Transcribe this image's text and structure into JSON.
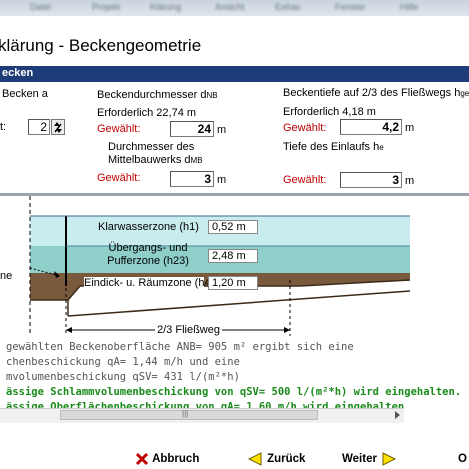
{
  "window": {
    "title": "klärung - Beckengeometrie",
    "section_title": "ecken",
    "blurred_tabs": [
      "Datei",
      "Projekt",
      "Klärung",
      "Ansicht",
      "Extras",
      "Fenster",
      "Hilfe"
    ]
  },
  "form": {
    "becken_label": "Becken a",
    "count_label": "t:",
    "count_value": "2",
    "durchmesser_label": "Beckendurchmesser d",
    "durchmesser_sub": "NB",
    "durchmesser_required": "Erforderlich 22,74 m",
    "gewaehlt_label": "Gewählt:",
    "durchmesser_value": "24",
    "unit_m": "m",
    "mittel_label_1": "Durchmesser des",
    "mittel_label_2": "Mittelbauwerks d",
    "mittel_sub": "MB",
    "mittel_value": "3",
    "tiefe_label": "Beckentiefe auf 2/3 des Fließwegs h",
    "tiefe_sub": "ges",
    "tiefe_required": "Erforderlich 4,18 m",
    "tiefe_value": "4,2",
    "einlauf_label": "Tiefe des Einlaufs h",
    "einlauf_sub": "e",
    "einlauf_value": "3"
  },
  "diagram": {
    "zone1_label": "Klarwasserzone (h1)",
    "zone1_value": "0,52 m",
    "zone2_label_1": "Übergangs- und",
    "zone2_label_2": "Pufferzone (h23)",
    "zone2_value": "2,48 m",
    "zone3_label": "Eindick- u. Räumzone (h4)",
    "zone3_value": "1,20 m",
    "fliessweg_label": "2/3 Fließweg",
    "left_label": "ne"
  },
  "messages": [
    {
      "text": "gewählten Beckenoberfläche ANB=  905 m² ergibt sich eine",
      "color": "gray"
    },
    {
      "text": "chenbeschickung qA= 1,44 m/h und eine",
      "color": "gray"
    },
    {
      "text": "mvolumenbeschickung qSV=  431 l/(m²*h)",
      "color": "gray"
    },
    {
      "text": "ässige Schlammvolumenbeschickung von qSV=  500 l/(m²*h) wird eingehalten.",
      "color": "green"
    },
    {
      "text": "ässige Oberflächenbeschickung von qA= 1,60 m/h wird eingehalten",
      "color": "green"
    }
  ],
  "scrollbar": {
    "grip": "|||"
  },
  "buttons": {
    "abbruch_label": "Abbruch",
    "zurueck_label": "Zurück",
    "weiter_label": "Weiter",
    "extra_label": "O"
  },
  "colors": {
    "section_bar": "#1e3d78",
    "water_light": "#c9ecef",
    "water_mid": "#8ecfca",
    "sludge": "#7a5a3c",
    "ok_green": "#1a8a1a",
    "warn_red": "#c00000"
  }
}
